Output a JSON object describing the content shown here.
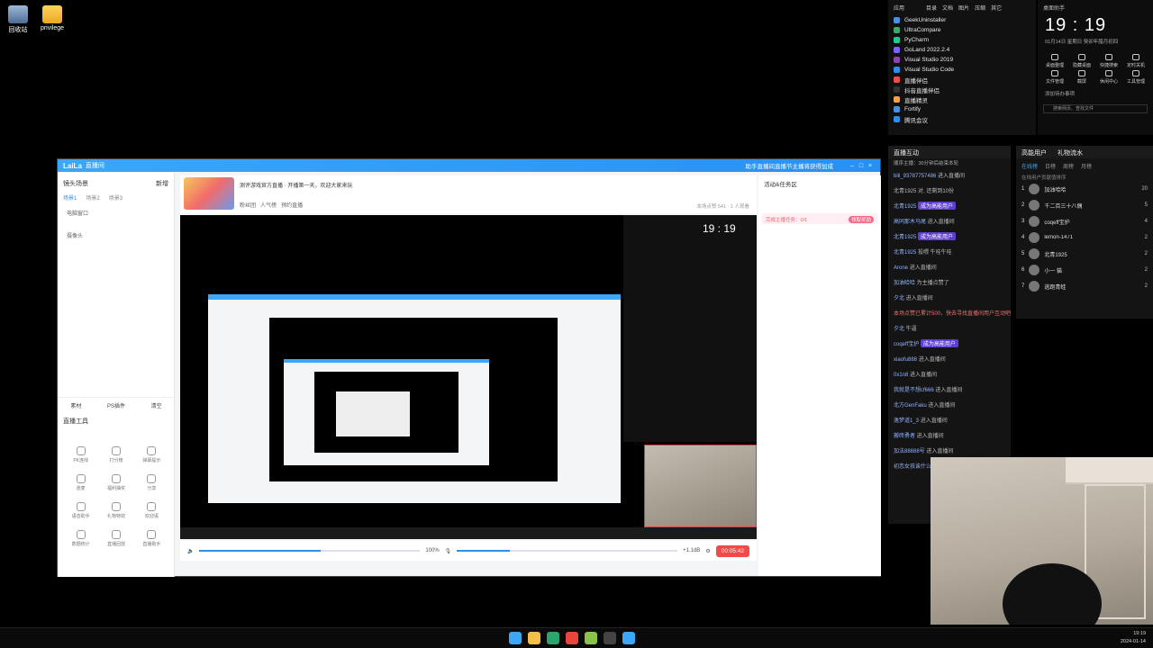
{
  "desktop": {
    "icons": [
      {
        "label": "回收站",
        "icon": "recycle-bin-icon"
      },
      {
        "label": "privilege",
        "icon": "folder-icon"
      }
    ]
  },
  "startmenu": {
    "header": [
      "应用",
      "目录",
      "文档",
      "图片",
      "压缩",
      "其它"
    ],
    "apps": [
      {
        "label": "GeekUninstaller",
        "color": "#4a90e2"
      },
      {
        "label": "UltraCompare",
        "color": "#3fa66b"
      },
      {
        "label": "PyCharm",
        "color": "#20c997"
      },
      {
        "label": "GoLand 2022.2.4",
        "color": "#7b61ff"
      },
      {
        "label": "Visual Studio 2019",
        "color": "#8e44ad"
      },
      {
        "label": "Visual Studio Code",
        "color": "#2b8ff0"
      },
      {
        "label": "直播伴侣",
        "color": "#f04a4a"
      },
      {
        "label": "抖音直播伴侣",
        "color": "#333333"
      },
      {
        "label": "直播精灵",
        "color": "#ff9f43"
      },
      {
        "label": "Fortify",
        "color": "#4a90e2"
      },
      {
        "label": "腾讯会议",
        "color": "#2b8ff0"
      }
    ]
  },
  "clock": {
    "label": "桌面助手",
    "time": "19 : 19",
    "date": "01月14日  星期日  癸卯年腊月初四",
    "tools": [
      "桌面整理",
      "隐藏桌面",
      "快捷搜索",
      "定时关机",
      "文件管理",
      "截屏",
      "休闲中心",
      "工具管理"
    ],
    "add_todo": "添加待办事项",
    "search_placeholder": "搜索网页、查找文件"
  },
  "app": {
    "brand": "LaiLa",
    "title": "直播间",
    "message": "助手直播间直播节主播将获得加成",
    "left": {
      "title": "镜头场景",
      "add": "新增",
      "tabs": [
        "场景1",
        "场景2",
        "场景3"
      ],
      "rows": [
        "电脑窗口",
        "摄像头"
      ],
      "bottom": [
        "素材",
        "PS插件",
        "清空"
      ],
      "tools_title": "直播工具",
      "tools": [
        "PK连线",
        "打分榜",
        "弹幕提示",
        "连麦",
        "福利抽奖",
        "分享",
        "语音助手",
        "礼物特效",
        "欢迎语",
        "数据统计",
        "直播回放",
        "直播助手"
      ]
    },
    "header": {
      "title": "测评游戏官方直播 · 开播第一天，欢迎大家来玩",
      "tags": [
        "游戏专区",
        "直播分享"
      ],
      "sub": [
        "粉丝团",
        "人气榜",
        "预约直播"
      ],
      "stats": "本场点赞 541  ·  1 人观看"
    },
    "preview_time": "19 : 19",
    "controls": {
      "zoom": "100%",
      "volume": "+1.1dB",
      "live_button": "00:05:42",
      "volume_level": 0.55,
      "mic_level": 0.24
    },
    "right": {
      "title": "活动&任务区",
      "note": "完成主播任务：0/1",
      "badge": "领取奖励"
    }
  },
  "chat": {
    "title": "直播互动",
    "top": "顺序主播：30分钟后结束本轮",
    "lines": [
      {
        "user": "bili_93787757486",
        "text": "进入直播间"
      },
      {
        "user": "",
        "text": "北青1925 对, 还剩到10份"
      },
      {
        "user": "北青1925",
        "text": "成为高能用户",
        "tag": true
      },
      {
        "user": "高同那木马尾",
        "text": "进入直播间"
      },
      {
        "user": "北青1925",
        "text": "成为高能用户",
        "tag": true
      },
      {
        "user": "北青1925",
        "text": "投喂 牛哇牛哇"
      },
      {
        "user": "Arone",
        "text": "进入直播间"
      },
      {
        "user": "加油哈哈",
        "text": "为主播点赞了"
      },
      {
        "user": "夕北",
        "text": "进入直播间"
      },
      {
        "user": "",
        "text": "本场点赞已累计500，快去寻找直播间用户互动吧~",
        "hl": true
      },
      {
        "user": "夕北",
        "text": "牛逼"
      },
      {
        "user": "coqeff宝护",
        "text": "成为高能用户",
        "tag": true
      },
      {
        "user": "xiaofu888",
        "text": "进入直播间"
      },
      {
        "user": "0x1n8",
        "text": "进入直播间"
      },
      {
        "user": "我就是不想cf666",
        "text": "进入直播间"
      },
      {
        "user": "北方GenFaku",
        "text": "进入直播间"
      },
      {
        "user": "逸梦道1_3",
        "text": "进入直播间"
      },
      {
        "user": "搬砖勇者",
        "text": "进入直播间"
      },
      {
        "user": "加法88888号",
        "text": "进入直播间"
      },
      {
        "user": "初恋女孩诶什么",
        "text": "进入直播间"
      }
    ]
  },
  "users": {
    "title": "高能用户",
    "title2": "礼物流水",
    "tabs": [
      "在线榜",
      "日榜",
      "周榜",
      "月榜"
    ],
    "sub": "在线用户贡献值排序",
    "rows": [
      {
        "rank": "1",
        "name": "加油哈哈",
        "count": "20"
      },
      {
        "rank": "2",
        "name": "千二百三十八偶",
        "count": "5"
      },
      {
        "rank": "3",
        "name": "coqeff宝护",
        "count": "4"
      },
      {
        "rank": "4",
        "name": "lemon-1471",
        "count": "2"
      },
      {
        "rank": "5",
        "name": "北青1925",
        "count": "2"
      },
      {
        "rank": "6",
        "name": "小一 猫",
        "count": "2"
      },
      {
        "rank": "7",
        "name": "逃跑青蛙",
        "count": "2"
      }
    ]
  },
  "taskbar": {
    "time": "19:19",
    "date": "2024-01-14",
    "apps": [
      {
        "icon": "windows-start-icon",
        "color": "#3da6f5"
      },
      {
        "icon": "file-explorer-icon",
        "color": "#f2c04a"
      },
      {
        "icon": "edge-browser-icon",
        "color": "#2ba56b"
      },
      {
        "icon": "chrome-icon",
        "color": "#e8453c"
      },
      {
        "icon": "notepad-icon",
        "color": "#8bc34a"
      },
      {
        "icon": "terminal-icon",
        "color": "#444444"
      },
      {
        "icon": "laila-live-icon",
        "color": "#3da6f5"
      }
    ]
  }
}
